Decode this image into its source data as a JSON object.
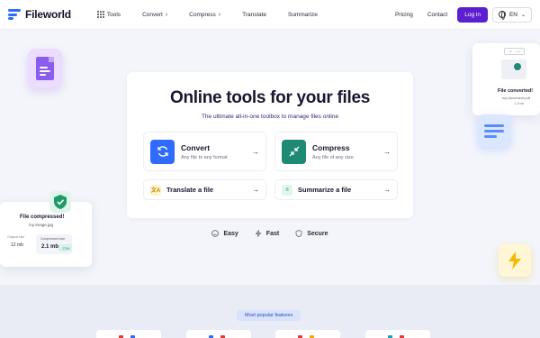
{
  "brand": {
    "name": "Fileworld",
    "accent": "#2f6bff",
    "primary": "#5b1fd1"
  },
  "nav": {
    "tools": "Tools",
    "convert": "Convert",
    "compress": "Compress",
    "translate": "Translate",
    "summarize": "Summarize",
    "pricing": "Pricing",
    "contact": "Contact",
    "login": "Log in",
    "language": "EN"
  },
  "hero": {
    "title": "Online tools for your files",
    "subtitle": "The ultimate all-in-one toolbox to manage files online"
  },
  "tools": {
    "convert": {
      "title": "Convert",
      "desc": "Any file to any format",
      "icon": "refresh-icon"
    },
    "compress": {
      "title": "Compress",
      "desc": "Any file of any size",
      "icon": "compress-arrows-icon"
    },
    "translate": {
      "title": "Translate a file",
      "icon": "translate-icon"
    },
    "summarize": {
      "title": "Summarize a file",
      "icon": "summarize-icon"
    }
  },
  "features": [
    {
      "label": "Easy",
      "icon": "smile-icon"
    },
    {
      "label": "Fast",
      "icon": "lightning-icon"
    },
    {
      "label": "Secure",
      "icon": "shield-icon"
    }
  ],
  "popular": {
    "label": "Most popular features"
  },
  "decorations": {
    "right_card": {
      "title": "File converted!",
      "filename": "my-document.pdf",
      "size": "1.2mb"
    },
    "left_card": {
      "title": "File compressed!",
      "filename": "my-image.jpg",
      "original_label": "Original size",
      "original_value": "12 mb",
      "compressed_label": "Compressed size",
      "compressed_value": "2.1 mb",
      "percent": "-73%"
    }
  }
}
